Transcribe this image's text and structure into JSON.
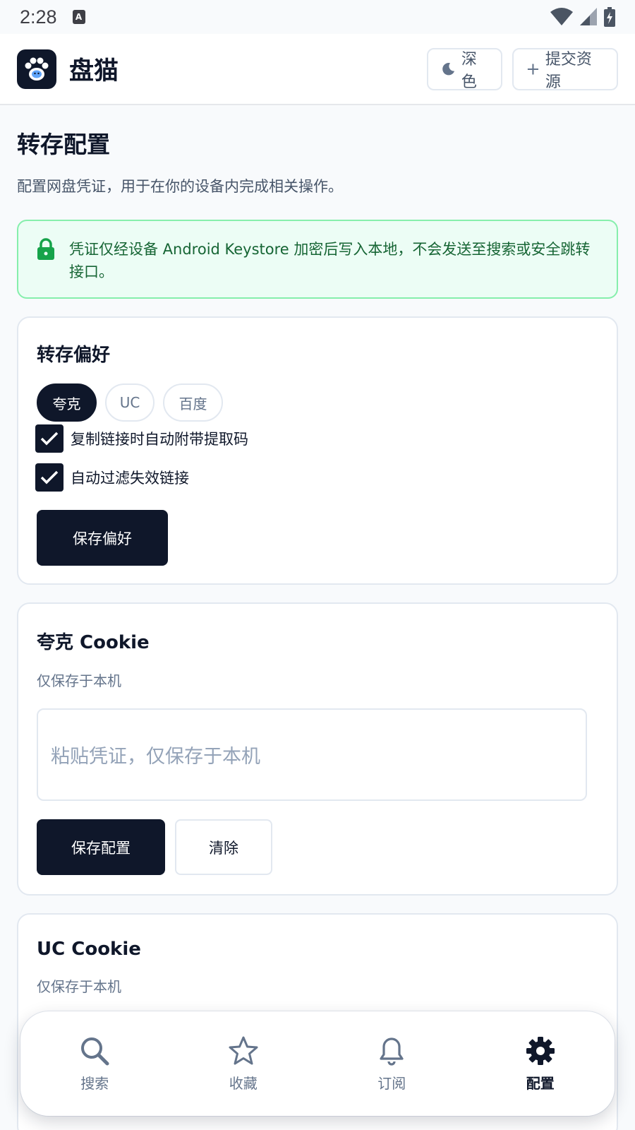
{
  "status_bar": {
    "time": "2:28",
    "notification_icon": "text-a-icon"
  },
  "header": {
    "app_name": "盘猫",
    "theme_button": "深色",
    "submit_button": "提交资源"
  },
  "page": {
    "title": "转存配置",
    "description": "配置网盘凭证，用于在你的设备内完成相关操作。"
  },
  "notice": {
    "text": "凭证仅经设备 Android Keystore 加密后写入本地，不会发送至搜索或安全跳转接口。",
    "color": "#166534"
  },
  "preferences": {
    "title": "转存偏好",
    "chips": [
      "夸克",
      "UC",
      "百度"
    ],
    "selected_chip": "夸克",
    "options": [
      {
        "label": "复制链接时自动附带提取码",
        "checked": true
      },
      {
        "label": "自动过滤失效链接",
        "checked": true
      }
    ],
    "save_button": "保存偏好"
  },
  "quark": {
    "title": "夸克 Cookie",
    "subtitle": "仅保存于本机",
    "placeholder": "粘贴凭证，仅保存于本机",
    "save_button": "保存配置",
    "clear_button": "清除"
  },
  "uc": {
    "title": "UC Cookie",
    "subtitle": "仅保存于本机"
  },
  "nav": {
    "items": [
      {
        "label": "搜索",
        "icon": "search-icon",
        "active": false
      },
      {
        "label": "收藏",
        "icon": "star-icon",
        "active": false
      },
      {
        "label": "订阅",
        "icon": "bell-icon",
        "active": false
      },
      {
        "label": "配置",
        "icon": "gear-icon",
        "active": true
      }
    ]
  },
  "colors": {
    "primary": "#0f172a",
    "notice_bg": "#ecfdf5",
    "notice_border": "#86efac",
    "muted": "#64748b"
  }
}
